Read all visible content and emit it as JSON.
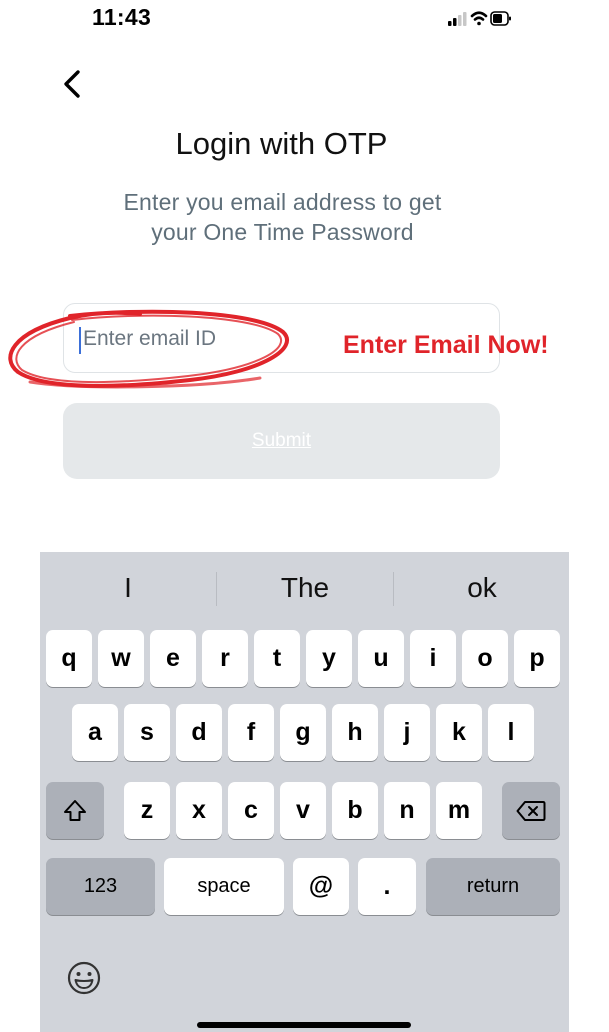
{
  "status_bar": {
    "time": "11:43"
  },
  "header": {
    "title": "Login with OTP",
    "subtitle_line1": "Enter you email address to get",
    "subtitle_line2": "your One Time Password"
  },
  "form": {
    "email_placeholder": "Enter email ID",
    "email_value": "",
    "submit_label": "Submit"
  },
  "annotation": {
    "text": "Enter Email Now!",
    "color": "#e0242a"
  },
  "keyboard": {
    "suggestions": [
      "I",
      "The",
      "ok"
    ],
    "row1": [
      "q",
      "w",
      "e",
      "r",
      "t",
      "y",
      "u",
      "i",
      "o",
      "p"
    ],
    "row2": [
      "a",
      "s",
      "d",
      "f",
      "g",
      "h",
      "j",
      "k",
      "l"
    ],
    "row3": [
      "z",
      "x",
      "c",
      "v",
      "b",
      "n",
      "m"
    ],
    "numbers_label": "123",
    "space_label": "space",
    "at_label": "@",
    "dot_label": ".",
    "return_label": "return",
    "shift_icon": "shift-icon",
    "backspace_icon": "backspace-icon",
    "emoji_icon": "emoji-icon"
  },
  "colors": {
    "accent": "#3b6fd8",
    "subtitle": "#5f6f7a",
    "keyboard_bg": "#d1d4da"
  }
}
